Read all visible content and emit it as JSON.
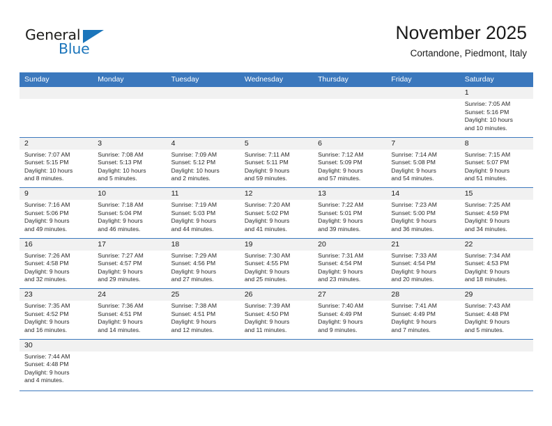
{
  "brand": {
    "name_top": "General",
    "name_bottom": "Blue",
    "accent_color": "#1b75bb"
  },
  "header": {
    "title": "November 2025",
    "subtitle": "Cortandone, Piedmont, Italy"
  },
  "calendar": {
    "header_color": "#3b78bd",
    "daynum_band_color": "#f1f1f1",
    "weekdays": [
      "Sunday",
      "Monday",
      "Tuesday",
      "Wednesday",
      "Thursday",
      "Friday",
      "Saturday"
    ],
    "weeks": [
      [
        {
          "day": "",
          "lines": []
        },
        {
          "day": "",
          "lines": []
        },
        {
          "day": "",
          "lines": []
        },
        {
          "day": "",
          "lines": []
        },
        {
          "day": "",
          "lines": []
        },
        {
          "day": "",
          "lines": []
        },
        {
          "day": "1",
          "lines": [
            "Sunrise: 7:05 AM",
            "Sunset: 5:16 PM",
            "Daylight: 10 hours",
            "and 10 minutes."
          ]
        }
      ],
      [
        {
          "day": "2",
          "lines": [
            "Sunrise: 7:07 AM",
            "Sunset: 5:15 PM",
            "Daylight: 10 hours",
            "and 8 minutes."
          ]
        },
        {
          "day": "3",
          "lines": [
            "Sunrise: 7:08 AM",
            "Sunset: 5:13 PM",
            "Daylight: 10 hours",
            "and 5 minutes."
          ]
        },
        {
          "day": "4",
          "lines": [
            "Sunrise: 7:09 AM",
            "Sunset: 5:12 PM",
            "Daylight: 10 hours",
            "and 2 minutes."
          ]
        },
        {
          "day": "5",
          "lines": [
            "Sunrise: 7:11 AM",
            "Sunset: 5:11 PM",
            "Daylight: 9 hours",
            "and 59 minutes."
          ]
        },
        {
          "day": "6",
          "lines": [
            "Sunrise: 7:12 AM",
            "Sunset: 5:09 PM",
            "Daylight: 9 hours",
            "and 57 minutes."
          ]
        },
        {
          "day": "7",
          "lines": [
            "Sunrise: 7:14 AM",
            "Sunset: 5:08 PM",
            "Daylight: 9 hours",
            "and 54 minutes."
          ]
        },
        {
          "day": "8",
          "lines": [
            "Sunrise: 7:15 AM",
            "Sunset: 5:07 PM",
            "Daylight: 9 hours",
            "and 51 minutes."
          ]
        }
      ],
      [
        {
          "day": "9",
          "lines": [
            "Sunrise: 7:16 AM",
            "Sunset: 5:06 PM",
            "Daylight: 9 hours",
            "and 49 minutes."
          ]
        },
        {
          "day": "10",
          "lines": [
            "Sunrise: 7:18 AM",
            "Sunset: 5:04 PM",
            "Daylight: 9 hours",
            "and 46 minutes."
          ]
        },
        {
          "day": "11",
          "lines": [
            "Sunrise: 7:19 AM",
            "Sunset: 5:03 PM",
            "Daylight: 9 hours",
            "and 44 minutes."
          ]
        },
        {
          "day": "12",
          "lines": [
            "Sunrise: 7:20 AM",
            "Sunset: 5:02 PM",
            "Daylight: 9 hours",
            "and 41 minutes."
          ]
        },
        {
          "day": "13",
          "lines": [
            "Sunrise: 7:22 AM",
            "Sunset: 5:01 PM",
            "Daylight: 9 hours",
            "and 39 minutes."
          ]
        },
        {
          "day": "14",
          "lines": [
            "Sunrise: 7:23 AM",
            "Sunset: 5:00 PM",
            "Daylight: 9 hours",
            "and 36 minutes."
          ]
        },
        {
          "day": "15",
          "lines": [
            "Sunrise: 7:25 AM",
            "Sunset: 4:59 PM",
            "Daylight: 9 hours",
            "and 34 minutes."
          ]
        }
      ],
      [
        {
          "day": "16",
          "lines": [
            "Sunrise: 7:26 AM",
            "Sunset: 4:58 PM",
            "Daylight: 9 hours",
            "and 32 minutes."
          ]
        },
        {
          "day": "17",
          "lines": [
            "Sunrise: 7:27 AM",
            "Sunset: 4:57 PM",
            "Daylight: 9 hours",
            "and 29 minutes."
          ]
        },
        {
          "day": "18",
          "lines": [
            "Sunrise: 7:29 AM",
            "Sunset: 4:56 PM",
            "Daylight: 9 hours",
            "and 27 minutes."
          ]
        },
        {
          "day": "19",
          "lines": [
            "Sunrise: 7:30 AM",
            "Sunset: 4:55 PM",
            "Daylight: 9 hours",
            "and 25 minutes."
          ]
        },
        {
          "day": "20",
          "lines": [
            "Sunrise: 7:31 AM",
            "Sunset: 4:54 PM",
            "Daylight: 9 hours",
            "and 23 minutes."
          ]
        },
        {
          "day": "21",
          "lines": [
            "Sunrise: 7:33 AM",
            "Sunset: 4:54 PM",
            "Daylight: 9 hours",
            "and 20 minutes."
          ]
        },
        {
          "day": "22",
          "lines": [
            "Sunrise: 7:34 AM",
            "Sunset: 4:53 PM",
            "Daylight: 9 hours",
            "and 18 minutes."
          ]
        }
      ],
      [
        {
          "day": "23",
          "lines": [
            "Sunrise: 7:35 AM",
            "Sunset: 4:52 PM",
            "Daylight: 9 hours",
            "and 16 minutes."
          ]
        },
        {
          "day": "24",
          "lines": [
            "Sunrise: 7:36 AM",
            "Sunset: 4:51 PM",
            "Daylight: 9 hours",
            "and 14 minutes."
          ]
        },
        {
          "day": "25",
          "lines": [
            "Sunrise: 7:38 AM",
            "Sunset: 4:51 PM",
            "Daylight: 9 hours",
            "and 12 minutes."
          ]
        },
        {
          "day": "26",
          "lines": [
            "Sunrise: 7:39 AM",
            "Sunset: 4:50 PM",
            "Daylight: 9 hours",
            "and 11 minutes."
          ]
        },
        {
          "day": "27",
          "lines": [
            "Sunrise: 7:40 AM",
            "Sunset: 4:49 PM",
            "Daylight: 9 hours",
            "and 9 minutes."
          ]
        },
        {
          "day": "28",
          "lines": [
            "Sunrise: 7:41 AM",
            "Sunset: 4:49 PM",
            "Daylight: 9 hours",
            "and 7 minutes."
          ]
        },
        {
          "day": "29",
          "lines": [
            "Sunrise: 7:43 AM",
            "Sunset: 4:48 PM",
            "Daylight: 9 hours",
            "and 5 minutes."
          ]
        }
      ],
      [
        {
          "day": "30",
          "lines": [
            "Sunrise: 7:44 AM",
            "Sunset: 4:48 PM",
            "Daylight: 9 hours",
            "and 4 minutes."
          ]
        },
        {
          "day": "",
          "lines": []
        },
        {
          "day": "",
          "lines": []
        },
        {
          "day": "",
          "lines": []
        },
        {
          "day": "",
          "lines": []
        },
        {
          "day": "",
          "lines": []
        },
        {
          "day": "",
          "lines": []
        }
      ]
    ]
  }
}
